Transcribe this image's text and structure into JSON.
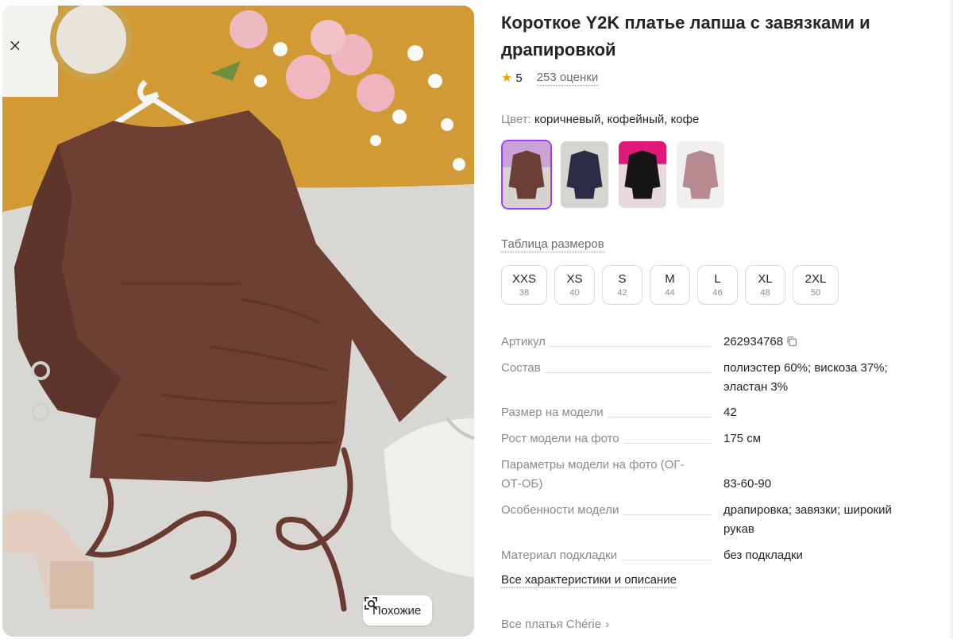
{
  "product": {
    "title": "Короткое Y2K платье лапша с завязками и драпировкой",
    "rating": "5",
    "reviews": "253 оценки"
  },
  "photo": {
    "similar_button": "Похожие",
    "icon": "image-search-icon"
  },
  "color": {
    "label": "Цвет:",
    "value": "коричневый, кофейный, кофе",
    "swatches": [
      {
        "name": "brown",
        "color": "#6b3f34",
        "selected": true
      },
      {
        "name": "navy",
        "color": "#2a2d45",
        "selected": false
      },
      {
        "name": "black",
        "color": "#161616",
        "selected": false
      },
      {
        "name": "wine",
        "color": "#7a2a35",
        "selected": false
      }
    ]
  },
  "sizes": {
    "table_link": "Таблица размеров",
    "items": [
      {
        "label": "XXS",
        "ru": "38"
      },
      {
        "label": "XS",
        "ru": "40"
      },
      {
        "label": "S",
        "ru": "42"
      },
      {
        "label": "M",
        "ru": "44"
      },
      {
        "label": "L",
        "ru": "46"
      },
      {
        "label": "XL",
        "ru": "48"
      },
      {
        "label": "2XL",
        "ru": "50"
      }
    ]
  },
  "specs": [
    {
      "key": "Артикул",
      "value": "262934768"
    },
    {
      "key": "Состав",
      "value": "полиэстер 60%; вискоза 37%; эластан 3%"
    },
    {
      "key": "Размер на модели",
      "value": "42"
    },
    {
      "key": "Рост модели на фото",
      "value": "175 см"
    },
    {
      "key": "Параметры модели на фото (ОГ-ОТ-ОБ)",
      "value": "83-60-90"
    },
    {
      "key": "Особенности модели",
      "value": "драпировка; завязки; широкий рукав"
    },
    {
      "key": "Материал подкладки",
      "value": "без подкладки"
    }
  ],
  "links": {
    "all_specs": "Все характеристики и описание",
    "all_dresses": "Все платья Chérie"
  }
}
